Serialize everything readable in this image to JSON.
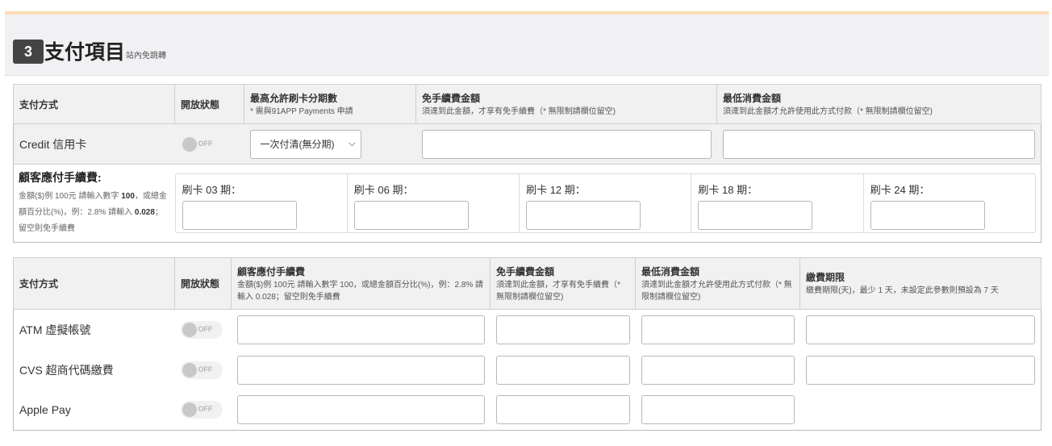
{
  "section": {
    "number": "3",
    "title": "支付項目",
    "subtitle": "站內免跳轉"
  },
  "credit_table": {
    "headers": {
      "method": "支付方式",
      "status": "開放狀態",
      "installments": {
        "label": "最高允許刷卡分期數",
        "note": "* 需與91APP Payments 申請"
      },
      "fee_free": {
        "label": "免手續費金額",
        "note": "須達到此金額，才享有免手續費（* 無限制請欄位留空)"
      },
      "min_spend": {
        "label": "最低消費金額",
        "note": "須達到此金額才允許使用此方式付款（* 無限制請欄位留空)"
      }
    },
    "row": {
      "method": "Credit 信用卡",
      "toggle": "OFF",
      "installment_value": "一次付清(無分期)",
      "fee_free_value": "",
      "min_spend_value": ""
    },
    "fee": {
      "label": "顧客應付手續費:",
      "desc_1": "金額($)例 100元 請輸入數字",
      "desc_bold_1": "100",
      "desc_2": "，或總金額百分比(%)，例：2.8% 請輸入",
      "desc_bold_2": "0.028",
      "desc_3": "；留空則免手續費"
    },
    "periods": [
      {
        "label": "刷卡 03 期：",
        "value": ""
      },
      {
        "label": "刷卡 06 期：",
        "value": ""
      },
      {
        "label": "刷卡 12 期：",
        "value": ""
      },
      {
        "label": "刷卡 18 期：",
        "value": ""
      },
      {
        "label": "刷卡 24 期：",
        "value": ""
      }
    ]
  },
  "other_table": {
    "headers": {
      "method": "支付方式",
      "status": "開放狀態",
      "fee": {
        "label": "顧客應付手續費",
        "note": "金額($)例 100元 請輸入數字 100，或總金額百分比(%)，例：2.8% 請輸入 0.028；留空則免手續費"
      },
      "fee_free": {
        "label": "免手續費金額",
        "note": "須達到此金額，才享有免手續費（* 無限制請欄位留空)"
      },
      "min_spend": {
        "label": "最低消費金額",
        "note": "須達到此金額才允許使用此方式付款（* 無限制請欄位留空)"
      },
      "deadline": {
        "label": "繳費期限",
        "note": "繳費期限(天)，最少 1 天，未設定此參數則預設為 7 天"
      }
    },
    "rows": [
      {
        "method": "ATM 虛擬帳號",
        "toggle": "OFF"
      },
      {
        "method": "CVS 超商代碼繳費",
        "toggle": "OFF"
      },
      {
        "method": "Apple Pay",
        "toggle": "OFF"
      }
    ]
  }
}
